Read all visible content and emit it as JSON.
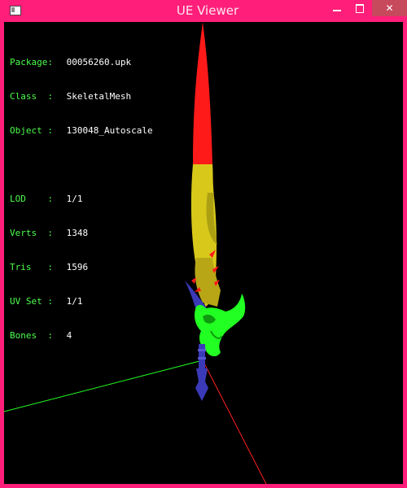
{
  "window": {
    "title": "UE Viewer"
  },
  "titlebar": {
    "minimize_label": "",
    "maximize_label": "",
    "close_label": "✕"
  },
  "info": {
    "package_label": "Package:",
    "package_value": "00056260.upk",
    "class_label": "Class  :",
    "class_value": "SkeletalMesh",
    "object_label": "Object :",
    "object_value": "130048_Autoscale",
    "lod_label": "LOD    :",
    "lod_value": "1/1",
    "verts_label": "Verts  :",
    "verts_value": "1348",
    "tris_label": "Tris   :",
    "tris_value": "1596",
    "uvset_label": "UV Set :",
    "uvset_value": "1/1",
    "bones_label": "Bones  :",
    "bones_value": "4"
  },
  "colors": {
    "frame": "#ff1f7a",
    "close_button": "#c7495c",
    "viewport_bg": "#000000",
    "info_label": "#4cff4c",
    "bone_red": "#ff1a1a",
    "bone_yellow": "#d8c81a",
    "bone_green": "#22ff22",
    "bone_blue": "#3a3ab8"
  }
}
